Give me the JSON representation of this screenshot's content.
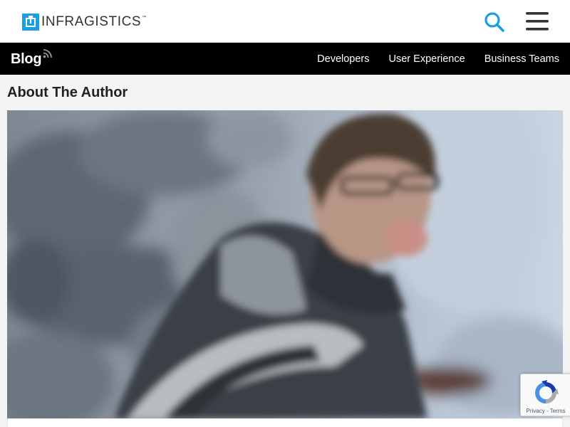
{
  "header": {
    "logo_text": "INFRAGISTICS",
    "logo_tm": "™",
    "search_icon": "search-icon",
    "menu_icon": "hamburger-menu-icon",
    "accent_color": "#1a9fe0"
  },
  "blog_nav": {
    "title": "Blog",
    "rss_icon": "rss-icon",
    "links": [
      "Developers",
      "User Experience",
      "Business Teams"
    ]
  },
  "main": {
    "heading": "About The Author",
    "author_photo": "author-photo"
  },
  "recaptcha": {
    "privacy": "Privacy",
    "separator": " - ",
    "terms": "Terms"
  }
}
